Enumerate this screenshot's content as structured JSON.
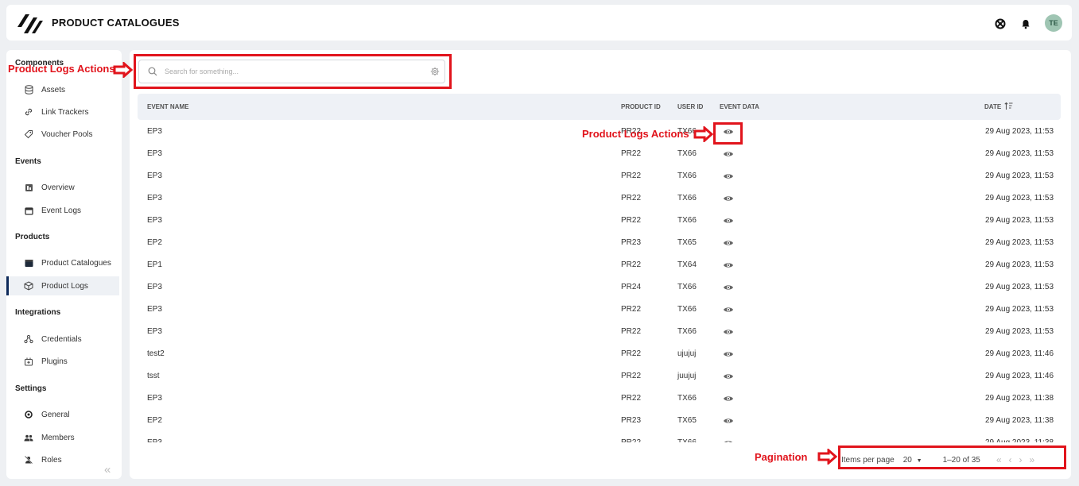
{
  "app": {
    "title": "PRODUCT CATALOGUES",
    "avatar_initials": "TE"
  },
  "sidebar": {
    "sections": [
      {
        "title": "Components",
        "items": [
          {
            "label": "Assets",
            "icon": "database-icon"
          },
          {
            "label": "Link Trackers",
            "icon": "link-icon"
          },
          {
            "label": "Voucher Pools",
            "icon": "tag-icon"
          }
        ]
      },
      {
        "title": "Events",
        "items": [
          {
            "label": "Overview",
            "icon": "chart-icon"
          },
          {
            "label": "Event Logs",
            "icon": "calendar-icon"
          }
        ]
      },
      {
        "title": "Products",
        "items": [
          {
            "label": "Product Catalogues",
            "icon": "catalogue-icon"
          },
          {
            "label": "Product Logs",
            "icon": "cube-icon",
            "active": true
          }
        ]
      },
      {
        "title": "Integrations",
        "items": [
          {
            "label": "Credentials",
            "icon": "credentials-icon"
          },
          {
            "label": "Plugins",
            "icon": "plugin-icon"
          }
        ]
      },
      {
        "title": "Settings",
        "items": [
          {
            "label": "General",
            "icon": "cog-icon"
          },
          {
            "label": "Members",
            "icon": "members-icon"
          },
          {
            "label": "Roles",
            "icon": "roles-icon"
          }
        ]
      }
    ]
  },
  "search": {
    "placeholder": "Search for something...",
    "value": ""
  },
  "table": {
    "columns": [
      "EVENT NAME",
      "PRODUCT ID",
      "USER ID",
      "EVENT DATA",
      "DATE"
    ],
    "rows": [
      {
        "event": "EP3",
        "product": "PR22",
        "user": "TX66",
        "date": "29 Aug 2023, 11:53"
      },
      {
        "event": "EP3",
        "product": "PR22",
        "user": "TX66",
        "date": "29 Aug 2023, 11:53"
      },
      {
        "event": "EP3",
        "product": "PR22",
        "user": "TX66",
        "date": "29 Aug 2023, 11:53"
      },
      {
        "event": "EP3",
        "product": "PR22",
        "user": "TX66",
        "date": "29 Aug 2023, 11:53"
      },
      {
        "event": "EP3",
        "product": "PR22",
        "user": "TX66",
        "date": "29 Aug 2023, 11:53"
      },
      {
        "event": "EP2",
        "product": "PR23",
        "user": "TX65",
        "date": "29 Aug 2023, 11:53"
      },
      {
        "event": "EP1",
        "product": "PR22",
        "user": "TX64",
        "date": "29 Aug 2023, 11:53"
      },
      {
        "event": "EP3",
        "product": "PR24",
        "user": "TX66",
        "date": "29 Aug 2023, 11:53"
      },
      {
        "event": "EP3",
        "product": "PR22",
        "user": "TX66",
        "date": "29 Aug 2023, 11:53"
      },
      {
        "event": "EP3",
        "product": "PR22",
        "user": "TX66",
        "date": "29 Aug 2023, 11:53"
      },
      {
        "event": "test2",
        "product": "PR22",
        "user": "ujujuj",
        "date": "29 Aug 2023, 11:46"
      },
      {
        "event": "tsst",
        "product": "PR22",
        "user": "juujuj",
        "date": "29 Aug 2023, 11:46"
      },
      {
        "event": "EP3",
        "product": "PR22",
        "user": "TX66",
        "date": "29 Aug 2023, 11:38"
      },
      {
        "event": "EP2",
        "product": "PR23",
        "user": "TX65",
        "date": "29 Aug 2023, 11:38"
      },
      {
        "event": "EP3",
        "product": "PR22",
        "user": "TX66",
        "date": "29 Aug 2023, 11:38"
      }
    ]
  },
  "pagination": {
    "items_per_page_label": "Items per page",
    "page_size": "20",
    "range": "1–20 of 35"
  },
  "annotations": {
    "search_label": "Product Logs Actions",
    "event_data_label": "Product Logs Actions",
    "pagination_label": "Pagination",
    "color": "#e1141c"
  }
}
